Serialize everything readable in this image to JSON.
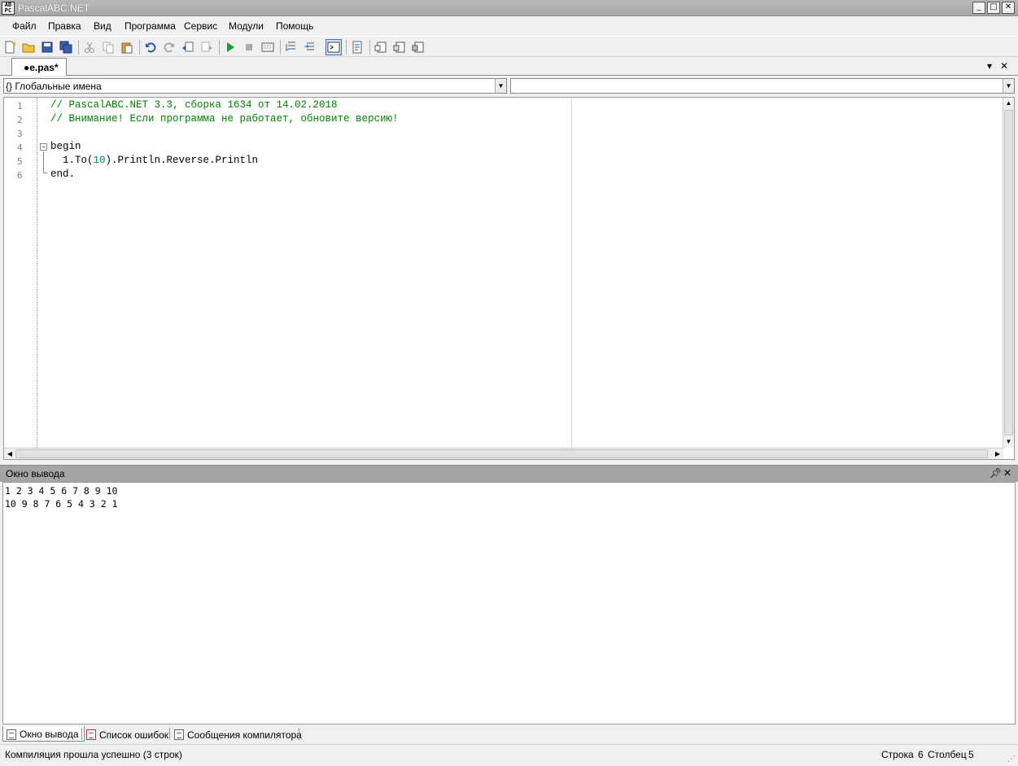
{
  "window": {
    "title": "PascalABC.NET",
    "icon_text": "AB PC"
  },
  "menu": [
    "Файл",
    "Правка",
    "Вид",
    "Программа",
    "Сервис",
    "Модули",
    "Помощь"
  ],
  "toolbar": {
    "icons": [
      "new-file",
      "open-file",
      "save",
      "save-all",
      "cut",
      "copy",
      "paste",
      "undo",
      "redo",
      "navigate-back",
      "navigate-forward",
      "run",
      "stop",
      "compile",
      "debug-step-into",
      "debug-step-over",
      "output-window",
      "find",
      "module-1",
      "module-2",
      "module-3"
    ]
  },
  "tabs": {
    "active": "●e.pas*"
  },
  "navigation": {
    "scope_value": "{} Глобальные имена",
    "member_value": ""
  },
  "editor": {
    "line_numbers": [
      "1",
      "2",
      "3",
      "4",
      "5",
      "6"
    ],
    "lines": [
      {
        "comment": "// PascalABC.NET 3.3, сборка 1634 от 14.02.2018"
      },
      {
        "comment": "// Внимание! Если программа не работает, обновите версию!"
      },
      {
        "text": ""
      },
      {
        "text": "begin"
      },
      {
        "pre": "  1.To(",
        "num": "10",
        "post": ").Println.Reverse.Println"
      },
      {
        "text": "end."
      }
    ]
  },
  "output_panel": {
    "title": "Окно вывода",
    "lines": [
      "1 2 3 4 5 6 7 8 9 10",
      "10 9 8 7 6 5 4 3 2 1"
    ]
  },
  "bottom_tabs": [
    "Окно вывода",
    "Список ошибок",
    "Сообщения компилятора"
  ],
  "status": {
    "message": "Компиляция прошла успешно (3 строк)",
    "row_label": "Строка",
    "row": "6",
    "col_label": "Столбец",
    "col": "5"
  }
}
